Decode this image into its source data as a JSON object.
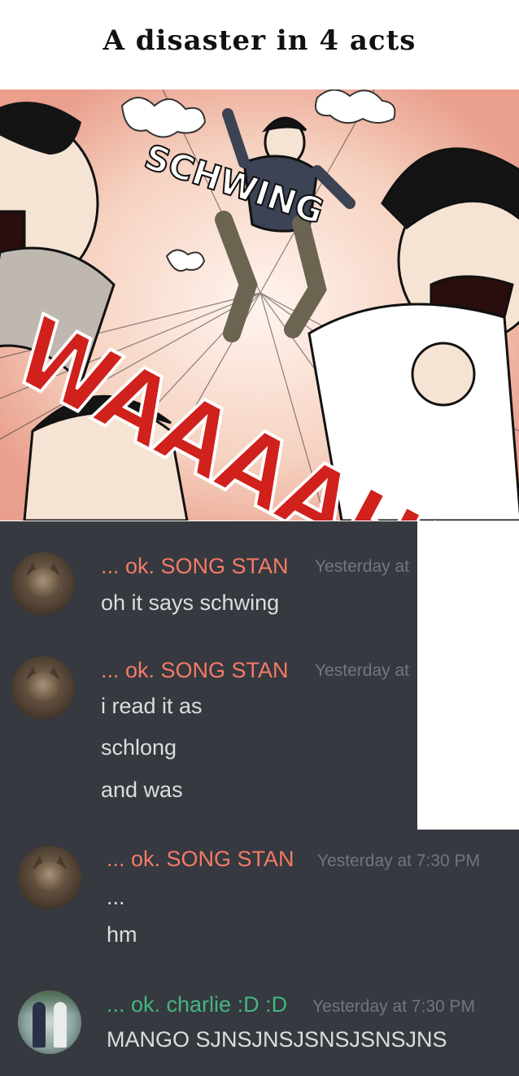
{
  "title": "A disaster in 4 acts",
  "comic": {
    "sfx_top": "SCHWING",
    "sfx_main": "WAAAAHHH"
  },
  "messages": [
    {
      "author": "... ok. SONG STAN",
      "timestamp": "Yesterday at",
      "lines": [
        "oh it says schwing"
      ],
      "avatar": "cat-avatar-icon"
    },
    {
      "author": "... ok. SONG STAN",
      "timestamp": "Yesterday at",
      "lines": [
        "i read it as",
        "schlong",
        "and was"
      ],
      "avatar": "cat-avatar-icon"
    },
    {
      "author": "... ok. SONG STAN",
      "timestamp": "Yesterday at 7:30 PM",
      "lines": [
        "...",
        "hm"
      ],
      "avatar": "cat-avatar-icon"
    },
    {
      "author": "... ok. charlie :D :D",
      "timestamp": "Yesterday at 7:30 PM",
      "lines": [
        "MANGO SJNSJNSJSNSJSNSJNS"
      ],
      "avatar": "two-figures-avatar-icon"
    }
  ],
  "colors": {
    "chat_bg": "#36393f",
    "name_red": "#f47b67",
    "name_green": "#43b581",
    "timestamp": "#72767d",
    "text": "#dcddde",
    "sfx_red": "#d0211c"
  }
}
